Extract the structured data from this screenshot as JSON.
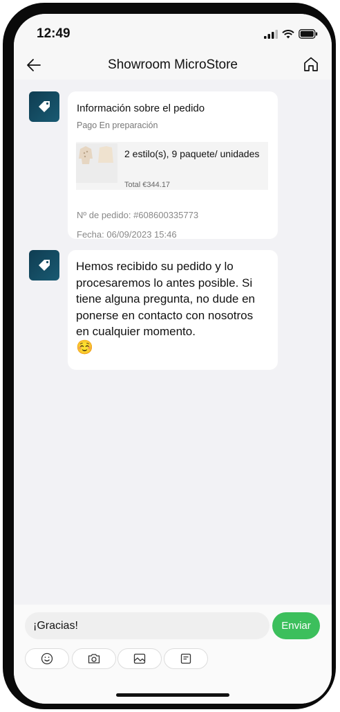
{
  "status_bar": {
    "time": "12:49"
  },
  "header": {
    "title": "Showroom MicroStore"
  },
  "order_card": {
    "title": "Información sobre el pedido",
    "status": "Pago En preparación",
    "product_summary": "2 estilo(s), 9 paquete/ unidades",
    "total": "Total €344.17",
    "order_number": "Nº de pedido: #608600335773",
    "date": "Fecha: 06/09/2023 15:46"
  },
  "message": {
    "text": "Hemos recibido su pedido y lo procesaremos lo antes posible. Si tiene alguna pregunta, no dude en ponerse en contacto con nosotros en cualquier momento.",
    "emoji": "☺️"
  },
  "composer": {
    "input_value": "¡Gracias!",
    "send_label": "Enviar"
  },
  "toolbar_icons": [
    "emoji-icon",
    "camera-icon",
    "image-icon",
    "order-icon"
  ],
  "colors": {
    "accent_green": "#3cbf5c",
    "avatar": "#164c63"
  }
}
